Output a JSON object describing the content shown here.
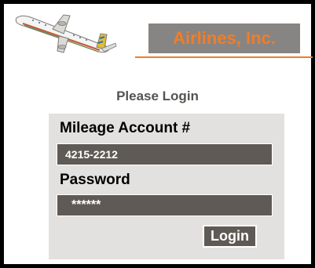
{
  "brand": {
    "name": "Airlines, Inc."
  },
  "logo": {
    "icon": "airplane-icon"
  },
  "login": {
    "title": "Please Login",
    "account_label": "Mileage Account #",
    "account_value": "4215-2212",
    "password_label": "Password",
    "password_value": "******",
    "submit_label": "Login"
  },
  "colors": {
    "background": "#000000",
    "accent": "#f07d29",
    "brand_box": "#878583",
    "panel": "#e2e1e0",
    "input": "#5f5a55"
  }
}
